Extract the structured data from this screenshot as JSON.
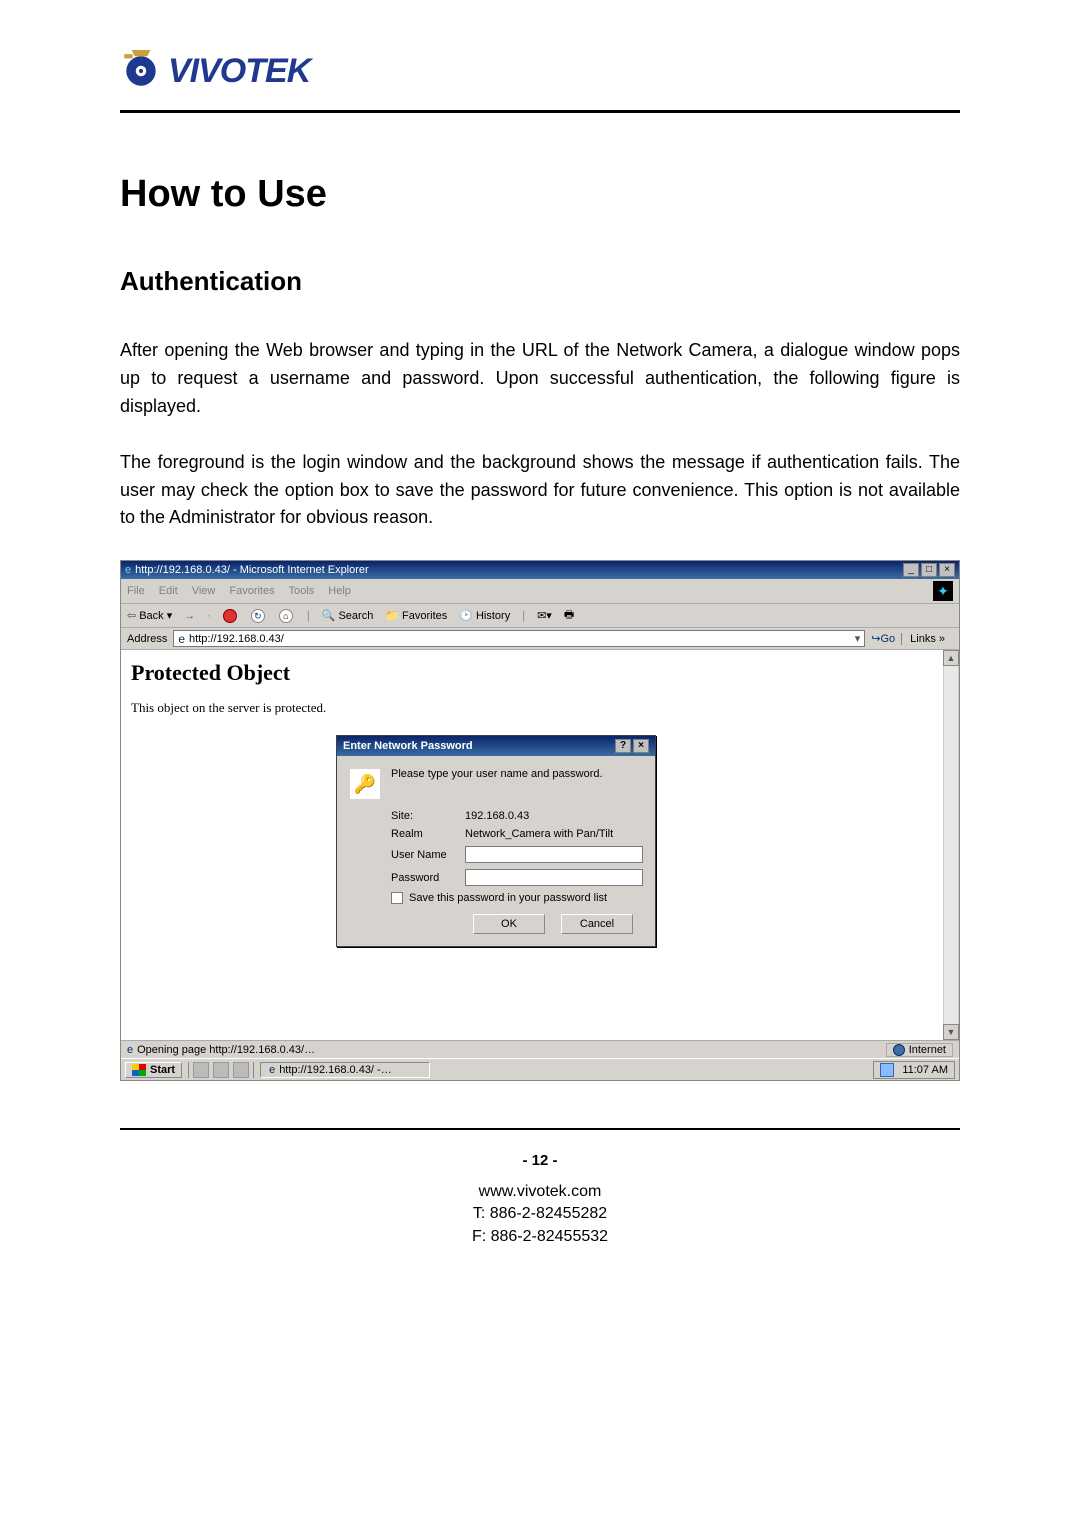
{
  "logo": {
    "text": "VIVOTEK"
  },
  "headings": {
    "h1": "How to Use",
    "h2": "Authentication"
  },
  "paragraphs": {
    "p1": "After opening the Web browser and typing in the URL of the Network Camera, a dialogue window pops up to request a username and password. Upon successful authentication, the following figure is displayed.",
    "p2": "The foreground is the login window and the background shows the message if authentication fails. The user may check the option box to save the password for future convenience.  This option is not available to the Administrator for obvious reason."
  },
  "ie": {
    "title": "http://192.168.0.43/ - Microsoft Internet Explorer",
    "menu": [
      "File",
      "Edit",
      "View",
      "Favorites",
      "Tools",
      "Help"
    ],
    "toolbar": {
      "back": "Back",
      "search": "Search",
      "favorites": "Favorites",
      "history": "History"
    },
    "address_label": "Address",
    "address_url": "http://192.168.0.43/",
    "go": "Go",
    "links": "Links »",
    "body": {
      "heading": "Protected Object",
      "sub": "This object on the server is protected."
    },
    "status_left": "Opening page http://192.168.0.43/…",
    "status_right": "Internet"
  },
  "dialog": {
    "title": "Enter Network Password",
    "prompt": "Please type your user name and password.",
    "site_label": "Site:",
    "site_value": "192.168.0.43",
    "realm_label": "Realm",
    "realm_value": "Network_Camera with Pan/Tilt",
    "user_label": "User Name",
    "pass_label": "Password",
    "checkbox": "Save this password in your password list",
    "ok": "OK",
    "cancel": "Cancel"
  },
  "taskbar": {
    "start": "Start",
    "task_item": "http://192.168.0.43/ -…",
    "time": "11:07 AM"
  },
  "footer": {
    "page": "- 12 -",
    "web": "www.vivotek.com",
    "tel": "T: 886-2-82455282",
    "fax": "F: 886-2-82455532"
  }
}
